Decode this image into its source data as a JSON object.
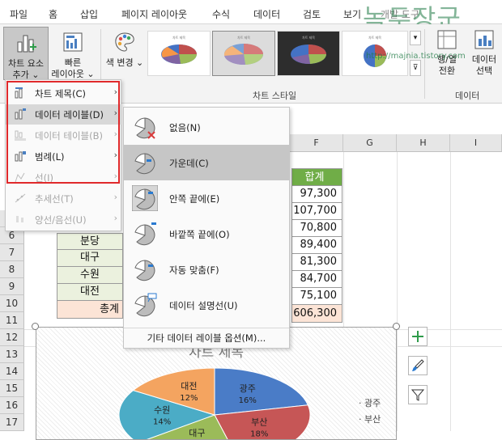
{
  "tabs": [
    "파일",
    "홈",
    "삽입",
    "페이지 레이아웃",
    "수식",
    "데이터",
    "검토",
    "보기",
    "개발 도구"
  ],
  "watermark": "녹두장군",
  "watermark_url": "http://majnia.tistory.com",
  "ribbon": {
    "add_element_line1": "차트 요소",
    "add_element_line2": "추가",
    "quick_layout_line1": "빠른",
    "quick_layout_line2": "레이아웃",
    "change_color": "색 변경",
    "chart_styles_label": "차트 스타일",
    "style_thumb_caption": "차트 제목",
    "switch_row_col_line1": "행/열",
    "switch_row_col_line2": "전환",
    "select_data_line1": "데이터",
    "select_data_line2": "선택",
    "data_group_label": "데이터",
    "gallery_down": "▾",
    "gallery_more": "⊽"
  },
  "menu1": {
    "items": [
      {
        "label": "차트 제목(C)",
        "disabled": false
      },
      {
        "label": "데이터 레이블(D)",
        "disabled": false
      },
      {
        "label": "데이터 테이블(B)",
        "disabled": true
      },
      {
        "label": "범례(L)",
        "disabled": false
      },
      {
        "label": "선(I)",
        "disabled": true
      },
      {
        "label": "추세선(T)",
        "disabled": true
      },
      {
        "label": "양선/음선(U)",
        "disabled": true
      }
    ]
  },
  "menu2": {
    "items": [
      {
        "label": "없음(N)"
      },
      {
        "label": "가운데(C)"
      },
      {
        "label": "안쪽 끝에(E)"
      },
      {
        "label": "바깥쪽 끝에(O)"
      },
      {
        "label": "자동 맞춤(F)"
      },
      {
        "label": "데이터 설명선(U)"
      }
    ],
    "more": "기타 데이터 레이블 옵션(M)..."
  },
  "grid": {
    "columns": [
      "F",
      "G",
      "H",
      "I"
    ],
    "rows": [
      "5",
      "6",
      "7",
      "8",
      "9",
      "10",
      "11",
      "12",
      "13",
      "14",
      "15",
      "16",
      "17"
    ],
    "total_header": "합계",
    "totals": [
      "97,300",
      "107,700",
      "70,800",
      "89,400",
      "81,300",
      "84,700",
      "75,100",
      "606,300"
    ],
    "cities": [
      "분당",
      "대구",
      "수원",
      "대전"
    ],
    "total_label": "총계"
  },
  "chart": {
    "title": "차트 제목",
    "chart_data": {
      "type": "pie",
      "title": "차트 제목",
      "labels": [
        "광주",
        "부산",
        "대구",
        "수원",
        "대전"
      ],
      "values": [
        16,
        18,
        14,
        14,
        12
      ],
      "value_labels": [
        "16%",
        "18%",
        "",
        "14%",
        "12%"
      ],
      "legend": [
        "광주",
        "부산"
      ],
      "legend_position": "right"
    }
  },
  "colors": {
    "excel_green": "#217346",
    "menu_border": "#e0292b",
    "total_header_bg": "#70ad47",
    "total_row_bg": "#fce4d6"
  }
}
